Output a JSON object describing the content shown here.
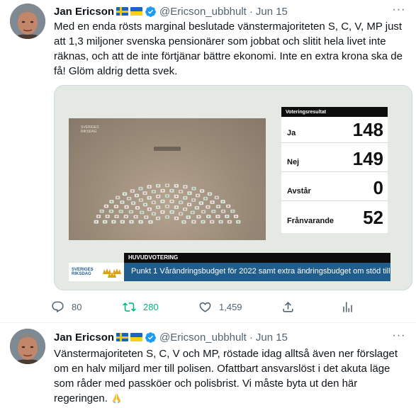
{
  "tweets": [
    {
      "author": {
        "name": "Jan Ericson",
        "handle": "@Ericson_ubbhult",
        "date": "Jun 15",
        "separator": "·",
        "flags": [
          "sweden-flag-icon",
          "ukraine-flag-icon"
        ],
        "verified_icon": "verified-badge-icon"
      },
      "text": "Med en enda rösts marginal beslutade vänstermajoriteten S, C, V, MP just att 1,3 miljoner svenska pensionärer som jobbat och slitit hela livet inte räknas, och att de inte förtjänar bättre ekonomi. Inte en extra krona ska de få! Glöm aldrig detta svek.",
      "media": {
        "chamber_watermark": "SVERIGES RIKSDAG",
        "results_title": "Voteringsresultat",
        "results": [
          {
            "label": "Ja",
            "value": "148"
          },
          {
            "label": "Nej",
            "value": "149"
          },
          {
            "label": "Avstår",
            "value": "0"
          },
          {
            "label": "Frånvarande",
            "value": "52"
          }
        ],
        "vote_type": "HUVUDVOTERING",
        "logo_text_line1": "SVERIGES",
        "logo_text_line2": "RIKSDAG",
        "caption": "Punkt 1 Vårändringsbudget för 2022 samt extra ändringsbudget om stöd till..."
      },
      "actions": {
        "replies": "80",
        "retweets": "280",
        "likes": "1,459",
        "share_icon": "share-icon",
        "analytics_icon": "analytics-icon"
      },
      "colors": {
        "retweet_active": "#00ba7c",
        "secondary_text": "#536471"
      }
    },
    {
      "author": {
        "name": "Jan Ericson",
        "handle": "@Ericson_ubbhult",
        "date": "Jun 15",
        "separator": "·",
        "flags": [
          "sweden-flag-icon",
          "ukraine-flag-icon"
        ],
        "verified_icon": "verified-badge-icon"
      },
      "text": "Vänstermajoriteten S, C, V och MP, röstade idag alltså även ner förslaget om en halv miljard mer till polisen. Ofattbart ansvarslöst i det akuta läge som råder med passköer och polisbrist. Vi måste byta ut den här regeringen.",
      "emoji": "folded-hands-emoji"
    }
  ]
}
